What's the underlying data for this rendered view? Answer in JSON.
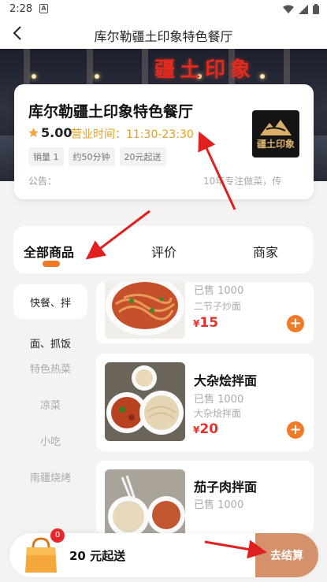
{
  "status": {
    "time": "2:28",
    "notif_glyph": "A"
  },
  "nav": {
    "title": "库尔勒疆土印象特色餐厅"
  },
  "hero": {
    "sign_text": "疆土印象"
  },
  "shop": {
    "name": "库尔勒疆土印象特色餐厅",
    "score": "5.00",
    "hours": "营业时间：11:30-23:30",
    "tags": [
      "销量 1",
      "约50分钟",
      "20元起送"
    ],
    "notice_label": "公告：",
    "notice_text": "10年专注做菜，传",
    "logo_text": "疆土印象"
  },
  "tabs": [
    {
      "label": "全部商品",
      "active": true
    },
    {
      "label": "评价",
      "active": false
    },
    {
      "label": "商家",
      "active": false
    }
  ],
  "categories": [
    {
      "label": "快餐、拌",
      "state": "active"
    },
    {
      "label": "面、抓饭",
      "state": "dark"
    },
    {
      "label": "特色热菜",
      "state": "normal"
    },
    {
      "label": "凉菜",
      "state": "normal"
    },
    {
      "label": "小吃",
      "state": "normal"
    },
    {
      "label": "南疆烧烤",
      "state": "normal"
    }
  ],
  "products": [
    {
      "name": "",
      "sold": "已售 1000",
      "desc": "二节子炒面",
      "currency": "¥",
      "price": "15"
    },
    {
      "name": "大杂烩拌面",
      "sold": "已售 1000",
      "desc": "大杂烩拌面",
      "currency": "¥",
      "price": "20"
    },
    {
      "name": "茄子肉拌面",
      "sold": "已售 1000",
      "desc": "",
      "currency": "¥",
      "price": ""
    }
  ],
  "cart": {
    "count": "0",
    "min_order": "20 元起送",
    "checkout": "去结算"
  },
  "colors": {
    "accent": "#f07a26",
    "price": "#e3322b",
    "hours": "#e6a11b",
    "checkout": "#d5916b",
    "annotation": "#e02020"
  },
  "icons": [
    "back-arrow-icon",
    "star-icon",
    "add-icon",
    "shopping-bag-icon",
    "wifi-icon",
    "signal-icon",
    "battery-icon"
  ]
}
